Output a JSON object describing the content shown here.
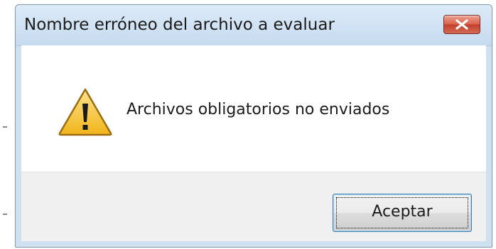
{
  "dialog": {
    "title": "Nombre erróneo del archivo a evaluar",
    "message": "Archivos obligatorios no enviados",
    "ok_label": "Aceptar",
    "icon": "warning-icon"
  },
  "colors": {
    "titlebar": "#cfe0f1",
    "close_button": "#c9503b",
    "footer": "#f0f0f0",
    "warning_fill": "#f6c631"
  }
}
